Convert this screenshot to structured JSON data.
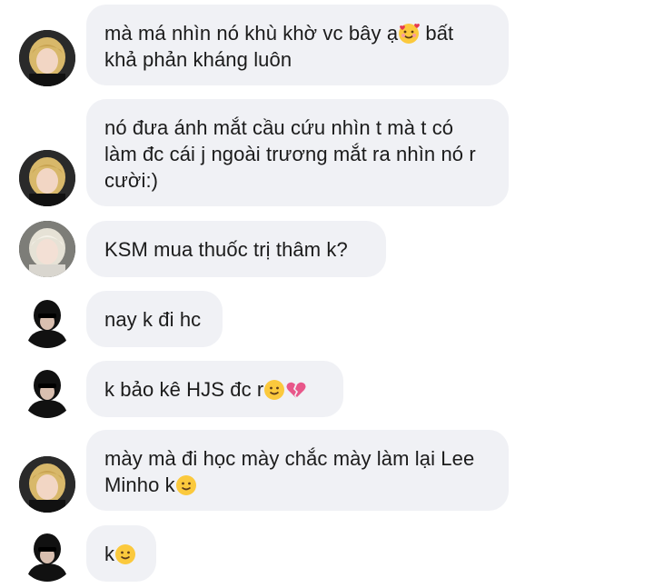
{
  "messages": [
    {
      "sender": "blonde",
      "text": "mà má nhìn nó khù khờ vc bây ạ",
      "emoji": "smiling-face-with-hearts-icon",
      "text_after": " bất khả phản kháng luôn"
    },
    {
      "sender": "blonde",
      "text": "nó đưa ánh mắt cầu cứu nhìn t mà t có làm đc cái j ngoài trương mắt ra nhìn nó r cười:)"
    },
    {
      "sender": "platinum",
      "text": "KSM mua thuốc trị thâm k?"
    },
    {
      "sender": "dark",
      "text": "nay k đi hc"
    },
    {
      "sender": "dark",
      "text": "k bảo kê HJS đc r",
      "emojis": [
        "slightly-smiling-face-icon",
        "broken-heart-icon"
      ]
    },
    {
      "sender": "blonde",
      "text": "mày mà đi học mày chắc mày làm lại Lee Minho k",
      "emoji": "slightly-smiling-face-icon"
    },
    {
      "sender": "dark",
      "text": "k",
      "emoji": "slightly-smiling-face-icon"
    }
  ],
  "colors": {
    "bubble": "#f0f1f5",
    "text": "#1b1b1b",
    "blonde_hair": "#d8b86a",
    "platinum_hair": "#e6e2d6",
    "dark_hair": "#111111"
  }
}
